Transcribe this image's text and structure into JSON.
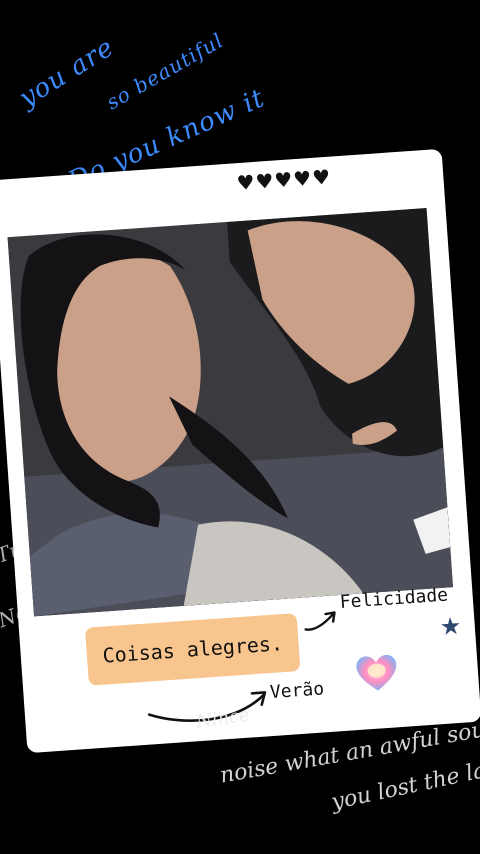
{
  "handwriting_top": {
    "line1": "you are",
    "line2": "so beautiful",
    "line3": "Do you know it"
  },
  "hearts": "♥♥♥♥♥",
  "caption": {
    "main": "Coisas alegres.",
    "felicidade": "Felicidade",
    "verao": "Verão"
  },
  "handwriting_bottom": {
    "line1": "Nince",
    "line2": "noise what an awful sound",
    "line3": "you lost the last"
  },
  "edge_fragments": {
    "a": "Tu",
    "b": "No"
  },
  "icons": {
    "star": "star-icon",
    "gradient_heart": "heart-icon"
  },
  "colors": {
    "background": "#000000",
    "label_fill": "#f9c58f",
    "handwriting_blue": "#3d8bff",
    "star": "#2e4870"
  }
}
